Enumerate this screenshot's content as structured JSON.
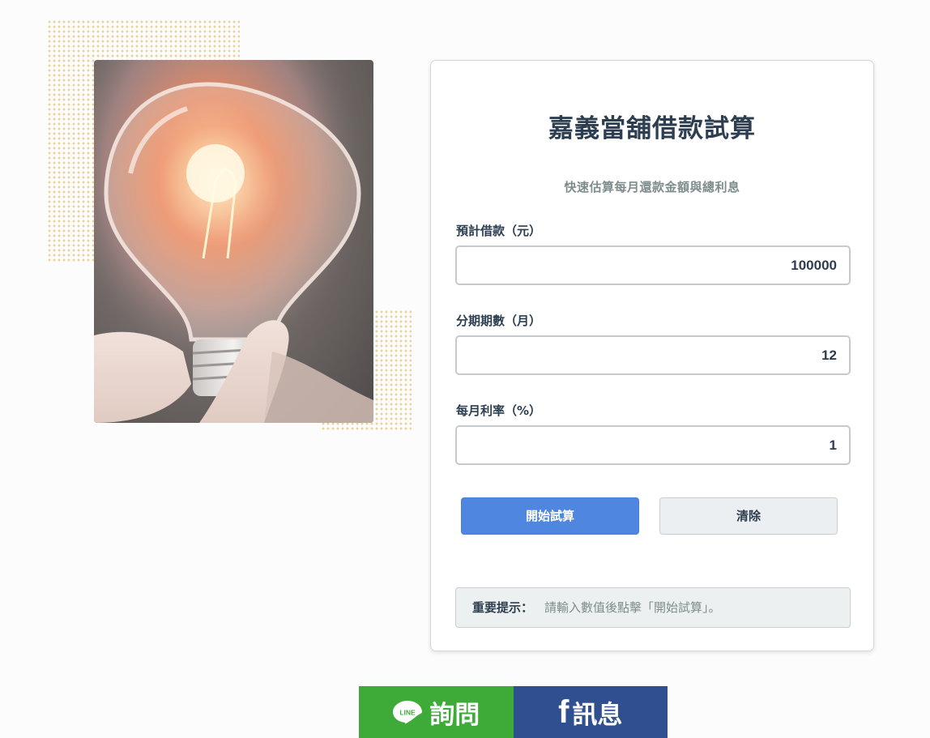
{
  "calculator": {
    "title": "嘉義當舖借款試算",
    "subtitle": "快速估算每月還款金額與總利息",
    "fields": [
      {
        "label": "預計借款（元）",
        "value": "100000"
      },
      {
        "label": "分期期數（月）",
        "value": "12"
      },
      {
        "label": "每月利率（%）",
        "value": "1"
      }
    ],
    "buttons": {
      "calculate": "開始試算",
      "clear": "清除"
    },
    "notice": {
      "label": "重要提示：",
      "text": "請輸入數值後點擊「開始試算」。"
    }
  },
  "contact": {
    "line_logo_text": "LINE",
    "line_label": "詢問",
    "fb_logo_text": "f",
    "fb_label": "訊息"
  },
  "colors": {
    "primary_button": "#4f86e0",
    "line_green": "#3eab38",
    "facebook_blue": "#2f4f91",
    "dot_pattern": "#ecd39a"
  },
  "icons": {
    "hero_image": "lightbulb-in-hand-photo",
    "line": "line-logo-icon",
    "facebook": "facebook-logo-icon"
  }
}
